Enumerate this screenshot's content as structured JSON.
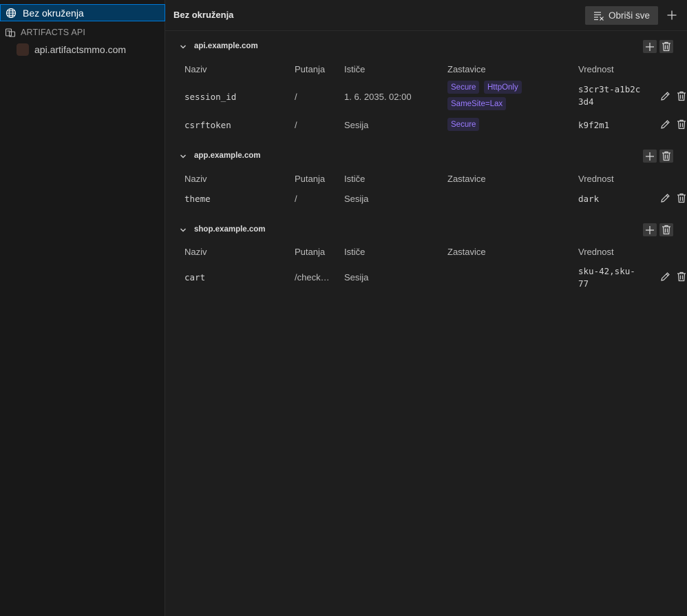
{
  "sidebar": {
    "selected_env": "Bez okruženja",
    "group_label": "ARTIFACTS API",
    "group_item": "api.artifactsmmo.com"
  },
  "header": {
    "title": "Bez okruženja",
    "clear_all_label": "Obriši sve"
  },
  "columns": [
    "Naziv",
    "Putanja",
    "Ističe",
    "Zastavice",
    "Vrednost"
  ],
  "domains": [
    {
      "name": "api.example.com",
      "cookies": [
        {
          "name": "session_id",
          "path": "/",
          "expires": "1. 6. 2035. 02:00",
          "flags": [
            "Secure",
            "HttpOnly",
            "SameSite=Lax"
          ],
          "value": "s3cr3t-a1b2c3d4"
        },
        {
          "name": "csrftoken",
          "path": "/",
          "expires": "Sesija",
          "flags": [
            "Secure"
          ],
          "value": "k9f2m1"
        }
      ]
    },
    {
      "name": "app.example.com",
      "cookies": [
        {
          "name": "theme",
          "path": "/",
          "expires": "Sesija",
          "flags": [],
          "value": "dark"
        }
      ]
    },
    {
      "name": "shop.example.com",
      "cookies": [
        {
          "name": "cart",
          "path": "/check…",
          "expires": "Sesija",
          "flags": [],
          "value": "sku-42,sku-77"
        }
      ]
    }
  ],
  "colors": {
    "accent": "#0078d4",
    "selected_bg": "#04395e",
    "tag_text": "#9b7bff",
    "tag_bg": "#2b2840"
  },
  "icons": [
    "globe-icon",
    "environment-group-icon",
    "clear-all-icon",
    "plus-icon",
    "chevron-down-icon",
    "trash-icon",
    "pencil-icon"
  ]
}
